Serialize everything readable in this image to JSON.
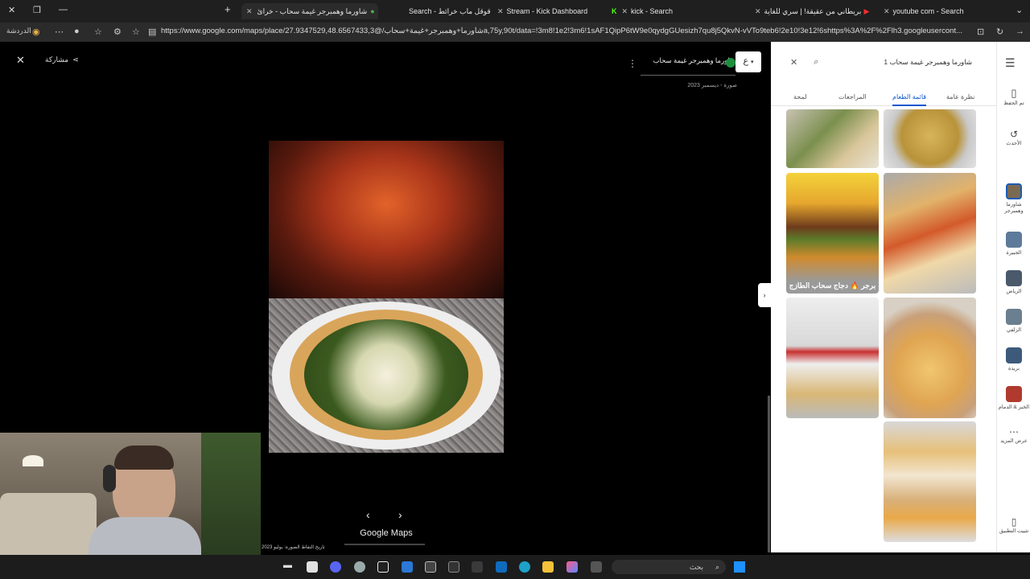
{
  "browser": {
    "tabs": [
      {
        "label": "شاورما وهمبرجر غيمة سحاب - خرائ",
        "active": true
      },
      {
        "label": "Search - قوقل ماب خرائط"
      },
      {
        "label": "Stream - Kick Dashboard"
      },
      {
        "label": "kick - Search"
      },
      {
        "label": "بريطاني من عقيقة! | سري للغاية - ..."
      },
      {
        "label": "youtube com - Search"
      }
    ],
    "url": "https://www.google.com/maps/place/شاورما+وهمبرجر+غيمة+سحاب/@27.9347529,48.6567433,3a,75y,90t/data=!3m8!1e2!3m6!1sAF1QipP6tW9e0qydgGUesizh7qu8j5QkvN-vVTo9teb6!2e10!3e12!6shttps%3A%2F%2Flh3.googleusercont...",
    "profile_label": "الدردشة"
  },
  "viewer": {
    "share_label": "مشاركة",
    "place_name": "شاورما وهمبرجر غيمة سحاب",
    "photo_date": "صورة - ديسمبر 2023",
    "brand": "Google Maps",
    "capture_date": "تاريخ التقاط الصورة: يوليو 2023",
    "avatar_letter": "ع"
  },
  "panel": {
    "search_value": "شاورما وهمبرجر غيمة سحاب 1",
    "tabs": [
      "لمحة",
      "المراجعات",
      "قائمة الطعام",
      "نظرة عامة"
    ],
    "selected_tab": "قائمة الطعام",
    "burger_caption": "برجر 🔥 دجاج سحاب الطازج"
  },
  "rail": {
    "items": [
      {
        "label": "تم الحفظ"
      },
      {
        "label": "الأحدث"
      },
      {
        "label": "شاورما وهمبرجر"
      },
      {
        "label": "الجبيرة"
      },
      {
        "label": "الرياض"
      },
      {
        "label": "الزلفي"
      },
      {
        "label": "بريدة"
      },
      {
        "label": "الخبر & الدمام"
      },
      {
        "label": "عرض المزيد"
      },
      {
        "label": "تثبيت التطبيق"
      }
    ]
  },
  "taskbar": {
    "search_placeholder": "بحث"
  },
  "colors": {
    "accent": "#0b57d0",
    "viewer_bg": "#000000",
    "tabbar_bg": "#1f1f1f"
  }
}
